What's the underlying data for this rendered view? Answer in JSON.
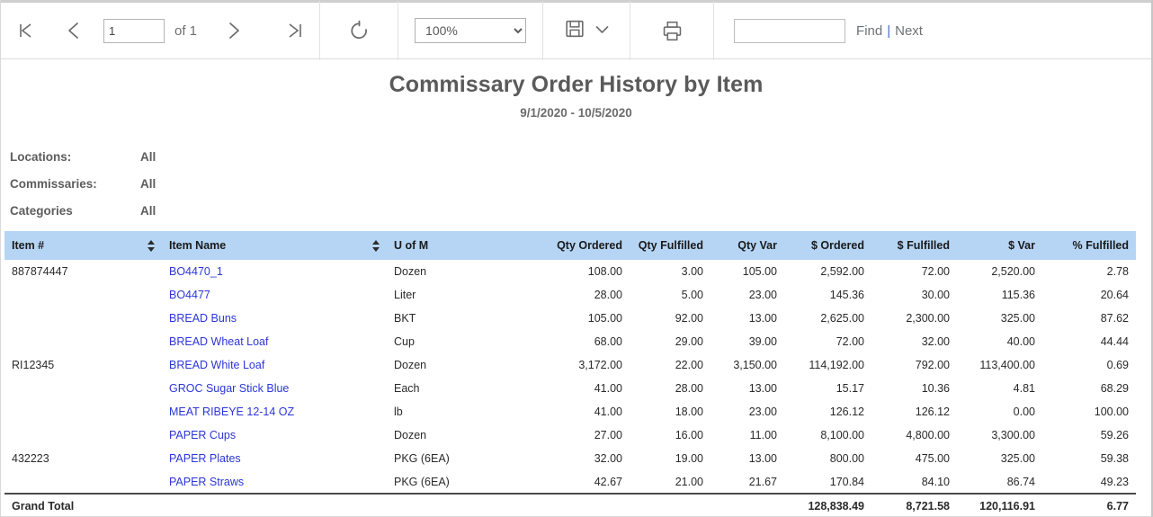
{
  "toolbar": {
    "first_page_icon": "first-page-icon",
    "prev_page_icon": "previous-page-icon",
    "next_page_icon": "next-page-icon",
    "last_page_icon": "last-page-icon",
    "page_value": "1",
    "page_of_label": "of 1",
    "refresh_icon": "refresh-icon",
    "zoom_value": "100%",
    "zoom_options": [
      "100%"
    ],
    "export_icon": "save-disk-icon",
    "export_caret_icon": "chevron-down-icon",
    "print_icon": "print-icon",
    "find_value": "",
    "find_placeholder": "",
    "find_label": "Find",
    "find_separator": "|",
    "next_label": "Next"
  },
  "report": {
    "title": "Commissary Order History by Item",
    "subtitle": "9/1/2020 - 10/5/2020",
    "filters": [
      {
        "label": "Locations:",
        "value": "All"
      },
      {
        "label": "Commissaries:",
        "value": "All"
      },
      {
        "label": "Categories",
        "value": "All"
      }
    ],
    "columns": [
      {
        "key": "item_no",
        "label": "Item #",
        "align": "left",
        "sortable": true
      },
      {
        "key": "item_name",
        "label": "Item Name",
        "align": "left",
        "sortable": true
      },
      {
        "key": "uom",
        "label": "U of M",
        "align": "left",
        "sortable": false
      },
      {
        "key": "qty_ordered",
        "label": "Qty Ordered",
        "align": "right",
        "sortable": false
      },
      {
        "key": "qty_fulfilled",
        "label": "Qty Fulfilled",
        "align": "right",
        "sortable": false
      },
      {
        "key": "qty_var",
        "label": "Qty Var",
        "align": "right",
        "sortable": false
      },
      {
        "key": "amt_ordered",
        "label": "$ Ordered",
        "align": "right",
        "sortable": false
      },
      {
        "key": "amt_fulfilled",
        "label": "$ Fulfilled",
        "align": "right",
        "sortable": false
      },
      {
        "key": "amt_var",
        "label": "$ Var",
        "align": "right",
        "sortable": false
      },
      {
        "key": "pct_fulfilled",
        "label": "% Fulfilled",
        "align": "right",
        "sortable": false
      }
    ],
    "rows": [
      {
        "item_no": "887874447",
        "item_name": "BO4470_1",
        "uom": "Dozen",
        "qty_ordered": "108.00",
        "qty_fulfilled": "3.00",
        "qty_var": "105.00",
        "amt_ordered": "2,592.00",
        "amt_fulfilled": "72.00",
        "amt_var": "2,520.00",
        "pct_fulfilled": "2.78"
      },
      {
        "item_no": "",
        "item_name": "BO4477",
        "uom": "Liter",
        "qty_ordered": "28.00",
        "qty_fulfilled": "5.00",
        "qty_var": "23.00",
        "amt_ordered": "145.36",
        "amt_fulfilled": "30.00",
        "amt_var": "115.36",
        "pct_fulfilled": "20.64"
      },
      {
        "item_no": "",
        "item_name": "BREAD Buns",
        "uom": "BKT",
        "qty_ordered": "105.00",
        "qty_fulfilled": "92.00",
        "qty_var": "13.00",
        "amt_ordered": "2,625.00",
        "amt_fulfilled": "2,300.00",
        "amt_var": "325.00",
        "pct_fulfilled": "87.62"
      },
      {
        "item_no": "",
        "item_name": "BREAD Wheat Loaf",
        "uom": "Cup",
        "qty_ordered": "68.00",
        "qty_fulfilled": "29.00",
        "qty_var": "39.00",
        "amt_ordered": "72.00",
        "amt_fulfilled": "32.00",
        "amt_var": "40.00",
        "pct_fulfilled": "44.44"
      },
      {
        "item_no": "RI12345",
        "item_name": "BREAD White Loaf",
        "uom": "Dozen",
        "qty_ordered": "3,172.00",
        "qty_fulfilled": "22.00",
        "qty_var": "3,150.00",
        "amt_ordered": "114,192.00",
        "amt_fulfilled": "792.00",
        "amt_var": "113,400.00",
        "pct_fulfilled": "0.69"
      },
      {
        "item_no": "",
        "item_name": "GROC Sugar Stick Blue",
        "uom": "Each",
        "qty_ordered": "41.00",
        "qty_fulfilled": "28.00",
        "qty_var": "13.00",
        "amt_ordered": "15.17",
        "amt_fulfilled": "10.36",
        "amt_var": "4.81",
        "pct_fulfilled": "68.29"
      },
      {
        "item_no": "",
        "item_name": "MEAT RIBEYE 12-14 OZ",
        "uom": "lb",
        "qty_ordered": "41.00",
        "qty_fulfilled": "18.00",
        "qty_var": "23.00",
        "amt_ordered": "126.12",
        "amt_fulfilled": "126.12",
        "amt_var": "0.00",
        "pct_fulfilled": "100.00"
      },
      {
        "item_no": "",
        "item_name": "PAPER Cups",
        "uom": "Dozen",
        "qty_ordered": "27.00",
        "qty_fulfilled": "16.00",
        "qty_var": "11.00",
        "amt_ordered": "8,100.00",
        "amt_fulfilled": "4,800.00",
        "amt_var": "3,300.00",
        "pct_fulfilled": "59.26"
      },
      {
        "item_no": "432223",
        "item_name": "PAPER Plates",
        "uom": "PKG (6EA)",
        "qty_ordered": "32.00",
        "qty_fulfilled": "19.00",
        "qty_var": "13.00",
        "amt_ordered": "800.00",
        "amt_fulfilled": "475.00",
        "amt_var": "325.00",
        "pct_fulfilled": "59.38"
      },
      {
        "item_no": "",
        "item_name": "PAPER Straws",
        "uom": "PKG (6EA)",
        "qty_ordered": "42.67",
        "qty_fulfilled": "21.00",
        "qty_var": "21.67",
        "amt_ordered": "170.84",
        "amt_fulfilled": "84.10",
        "amt_var": "86.74",
        "pct_fulfilled": "49.23"
      }
    ],
    "total_row": {
      "label": "Grand Total",
      "item_name": "",
      "uom": "",
      "qty_ordered": "",
      "qty_fulfilled": "",
      "qty_var": "",
      "amt_ordered": "128,838.49",
      "amt_fulfilled": "8,721.58",
      "amt_var": "120,116.91",
      "pct_fulfilled": "6.77"
    }
  },
  "colors": {
    "header_band": "#b6d5f5",
    "link": "#2c36d8",
    "title_text": "#5a5a5a",
    "total_rule": "#4a4a4a"
  }
}
